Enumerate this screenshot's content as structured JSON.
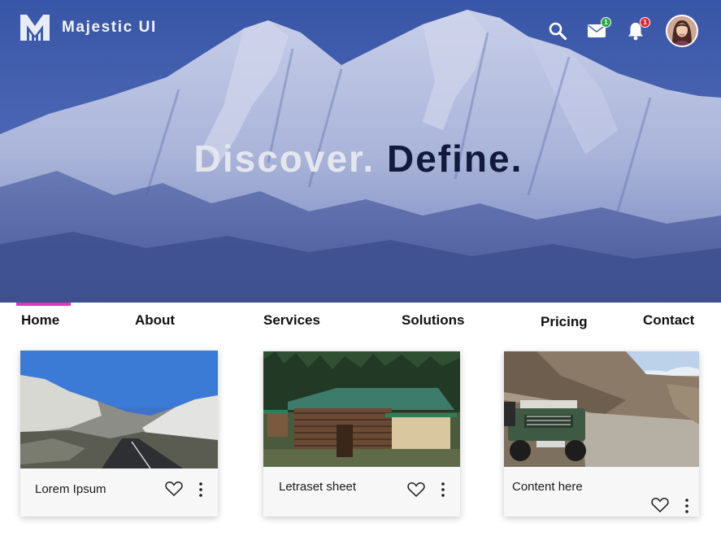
{
  "brand": {
    "name": "Majestic UI",
    "logo_icon": "brand-m-logo-icon"
  },
  "header": {
    "search_icon": "search-icon",
    "mail_badge": "1",
    "mail_badge_color": "#28a745",
    "bell_badge": "1",
    "bell_badge_color": "#e0242b"
  },
  "hero": {
    "word1": "Discover.",
    "word2": "Define."
  },
  "nav": {
    "active": "Home",
    "accent_color": "#e633b7",
    "items": [
      "Home",
      "About",
      "Services",
      "Solutions",
      "Pricing",
      "Contact"
    ]
  },
  "cards": [
    {
      "title": "Lorem Ipsum",
      "image": "mountain road with snow"
    },
    {
      "title": "Letraset sheet",
      "image": "wooden house in forest"
    },
    {
      "title": "Content here",
      "image": "jeep on mountain road"
    }
  ]
}
